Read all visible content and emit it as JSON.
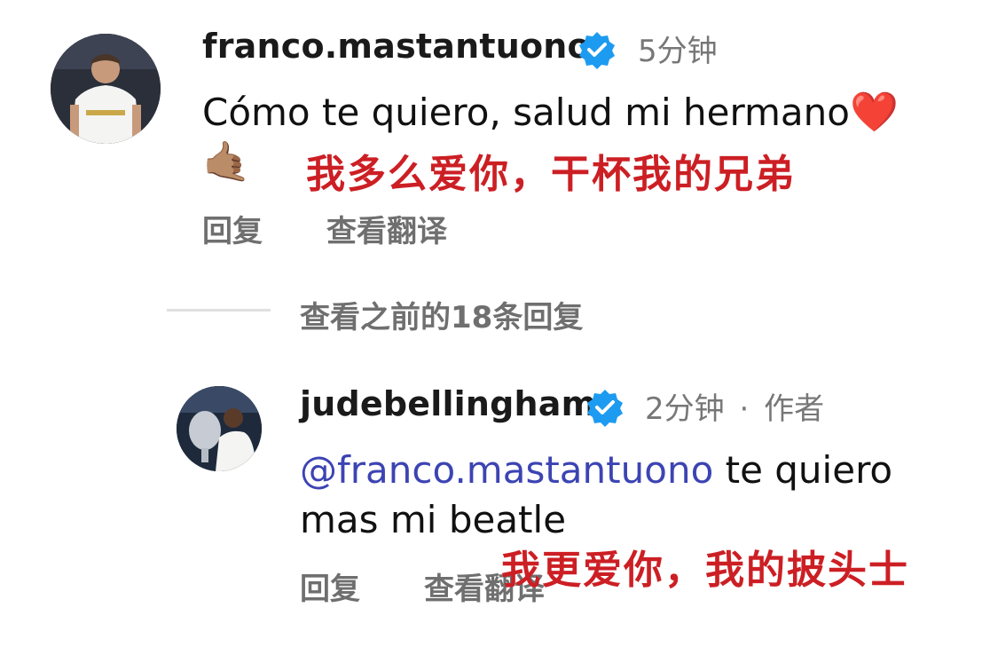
{
  "comment1": {
    "username": "franco.mastantuono",
    "time": "5分钟",
    "text": "Cómo te quiero, salud mi hermano",
    "heart_emoji": "❤️",
    "hand_emoji": "🤙🏽",
    "translation_overlay": "我多么爱你，干杯我的兄弟",
    "reply_label": "回复",
    "translate_label": "查看翻译"
  },
  "view_previous": "查看之前的18条回复",
  "comment2": {
    "username": "judebellingham",
    "time": "2分钟",
    "separator": "·",
    "author_label": "作者",
    "mention": "@franco.mastantuono",
    "text_line1_rest": " te quiero",
    "text_line2": "mas mi beatle",
    "translation_overlay": "我更爱你，我的披头士",
    "reply_label": "回复",
    "translate_label": "查看翻译"
  },
  "colors": {
    "verified_blue": "#1d9bf0",
    "mention_blue": "#3c44b3",
    "overlay_red": "#cc1f24"
  }
}
